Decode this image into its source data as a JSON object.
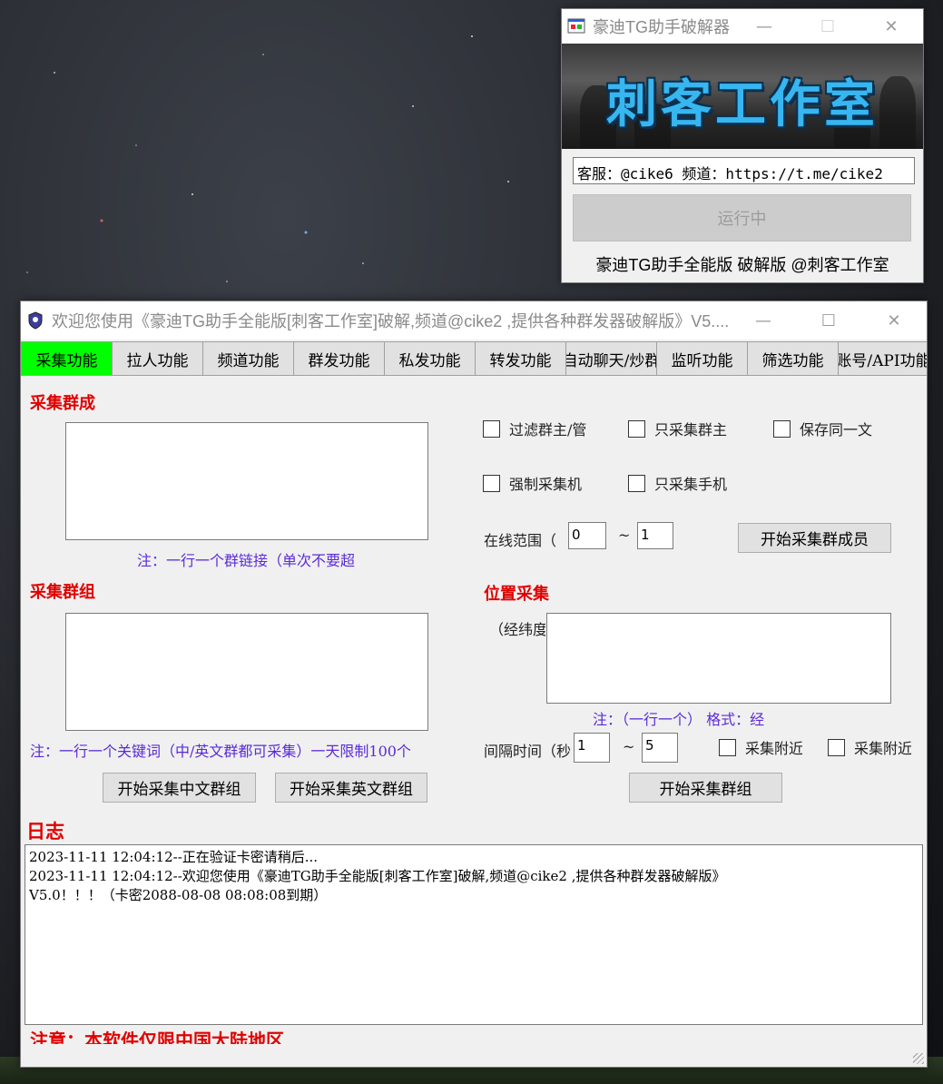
{
  "cracker_window": {
    "title": "豪迪TG助手破解器",
    "banner_text": "刺客工作室",
    "info_text": "客服：@cike6 频道：https://t.me/cike2",
    "run_button": "运行中",
    "footer": "豪迪TG助手全能版 破解版 @刺客工作室"
  },
  "main_window": {
    "title": "欢迎您使用《豪迪TG助手全能版[刺客工作室]破解,频道@cike2 ,提供各种群发器破解版》V5....",
    "tabs": [
      {
        "label": "采集功能",
        "active": true
      },
      {
        "label": "拉人功能"
      },
      {
        "label": "频道功能"
      },
      {
        "label": "群发功能"
      },
      {
        "label": "私发功能"
      },
      {
        "label": "转发功能"
      },
      {
        "label": "自动聊天/炒群"
      },
      {
        "label": "监听功能"
      },
      {
        "label": "筛选功能"
      },
      {
        "label": "账号/API功能"
      }
    ],
    "member_section": {
      "title": "采集群成",
      "note": "注：一行一个群链接（单次不要超",
      "checkboxes": [
        "过滤群主/管",
        "只采集群主",
        "保存同一文",
        "强制采集机",
        "只采集手机"
      ],
      "online_range_label": "在线范围（",
      "online_min": "0",
      "tilde": "~",
      "online_max": "1",
      "start_button": "开始采集群成员"
    },
    "group_section": {
      "title": "采集群组",
      "note": "注：一行一个关键词（中/英文群都可采集）一天限制100个",
      "btn_cn": "开始采集中文群组",
      "btn_en": "开始采集英文群组"
    },
    "location_section": {
      "title": "位置采集",
      "coord_label": "（经纬度",
      "note": "注：（一行一个） 格式：经",
      "interval_label": "间隔时间（秒",
      "interval_min": "1",
      "tilde": "~",
      "interval_max": "5",
      "chk1": "采集附近",
      "chk2": "采集附近",
      "start_button": "开始采集群组"
    },
    "log": {
      "title": "日志",
      "lines": [
        "2023-11-11 12:04:12--正在验证卡密请稍后...",
        "2023-11-11 12:04:12--欢迎您使用《豪迪TG助手全能版[刺客工作室]破解,频道@cike2 ,提供各种群发器破解版》",
        "V5.0！！！（卡密2088-08-08 08:08:08到期）"
      ]
    },
    "bottom_warning": "注意：本软件仅限中国大陆地区"
  }
}
